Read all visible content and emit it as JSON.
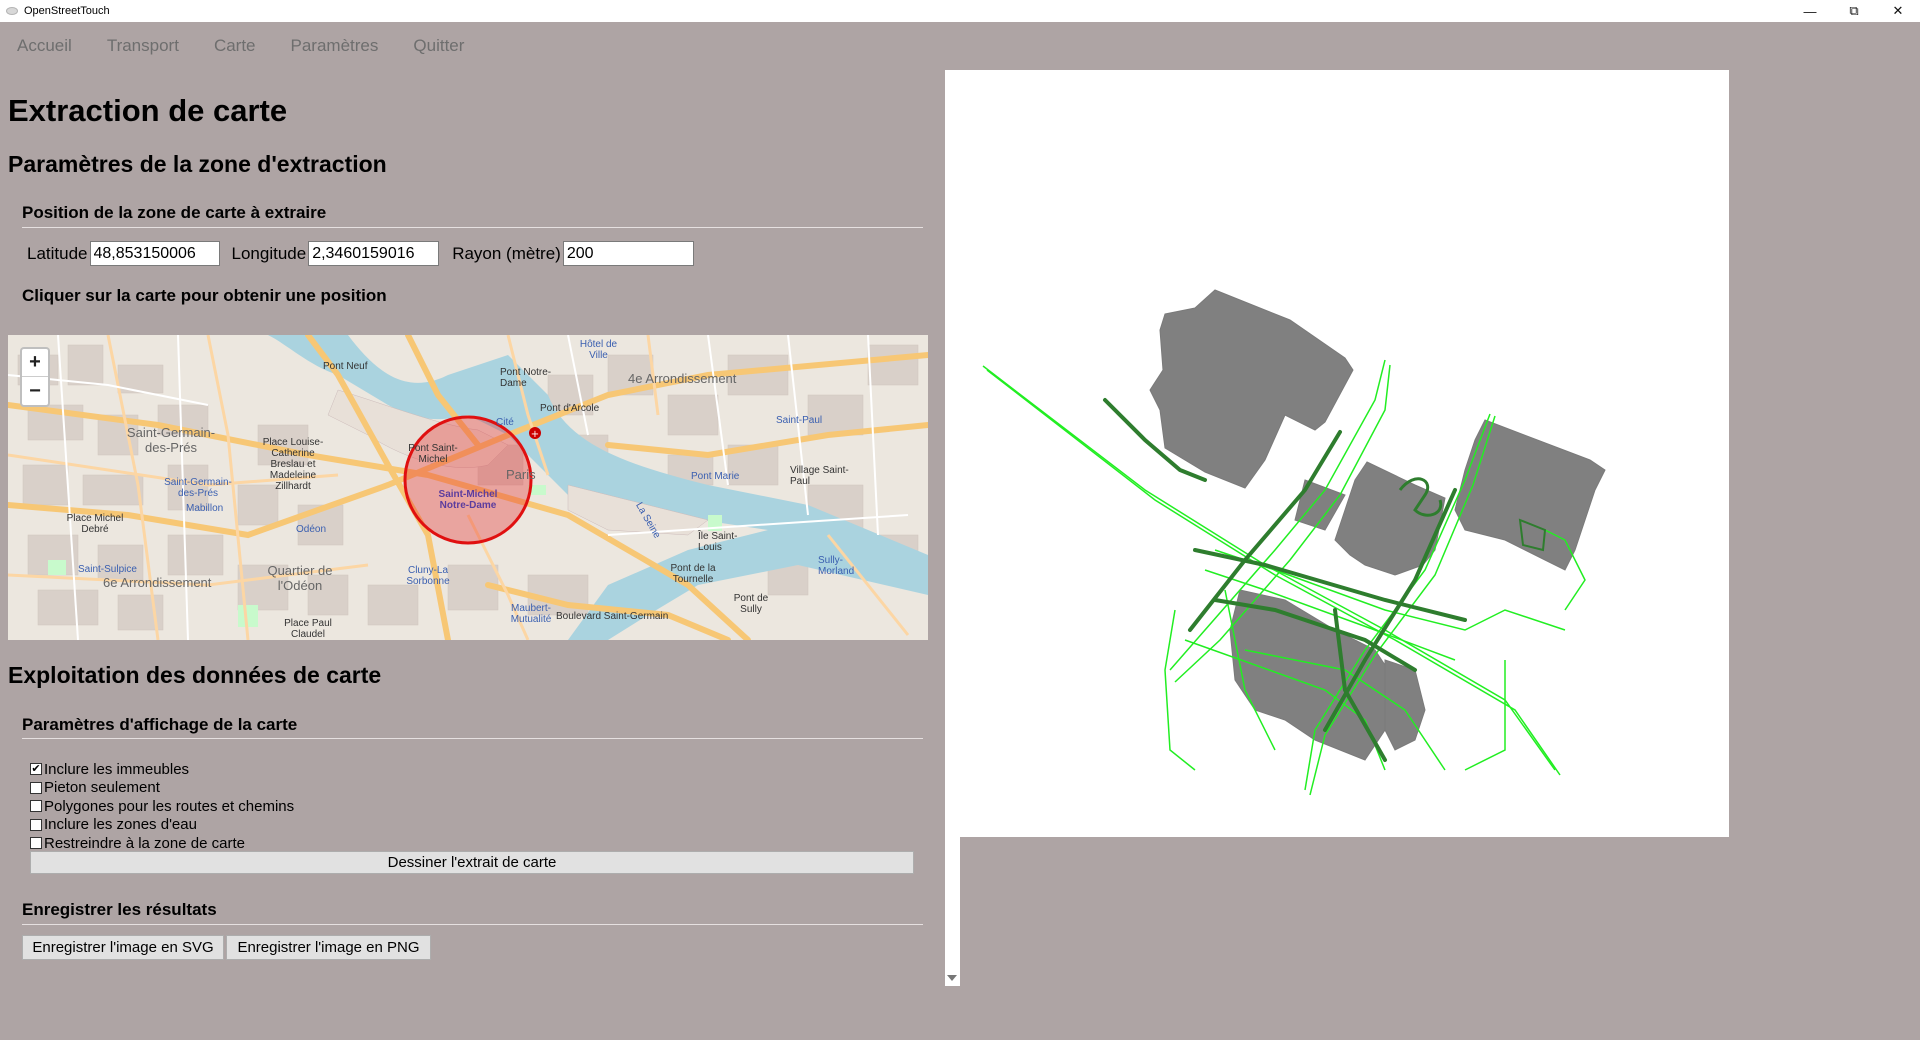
{
  "window": {
    "title": "OpenStreetTouch",
    "minimize": "—",
    "restore": "⧉",
    "close": "✕"
  },
  "menu": [
    "Accueil",
    "Transport",
    "Carte",
    "Paramètres",
    "Quitter"
  ],
  "page_title": "Extraction de carte",
  "extraction": {
    "heading": "Paramètres de la zone d'extraction",
    "position_heading": "Position de la zone de carte à extraire",
    "latitude_label": "Latitude",
    "latitude_value": "48,853150006",
    "longitude_label": "Longitude",
    "longitude_value": "2,3460159016",
    "radius_label": "Rayon (mètre)",
    "radius_value": "200",
    "click_hint": "Cliquer sur la carte pour obtenir une position"
  },
  "map": {
    "zoom_in": "+",
    "zoom_out": "−",
    "labels": {
      "paris": "Paris",
      "st_germain": "Saint-Germain-des-Prés",
      "quartier_odeon": "Quartier de l'Odéon",
      "arr6": "6e Arrondissement",
      "arr4": "4e Arrondissement",
      "st_michel_nd": "Saint-Michel Notre-Dame",
      "pont_neuf": "Pont Neuf",
      "pont_notre_dame": "Pont Notre-Dame",
      "pont_arcole": "Pont d'Arcole",
      "pont_tournelle": "Pont de la Tournelle",
      "pont_sully": "Pont de Sully",
      "pont_marie": "Pont Marie",
      "hotel_ville": "Hôtel de Ville",
      "cite": "Cité",
      "odeon": "Odéon",
      "mabillon": "Mabillon",
      "st_sulpice": "Saint-Sulpice",
      "cluny": "Cluny-La Sorbonne",
      "maubert": "Maubert-Mutualité",
      "bd_st_germain": "Boulevard Saint-Germain",
      "la_seine": "La Seine",
      "ile_st_louis": "Île Saint-Louis",
      "village_st_paul": "Village Saint-Paul",
      "st_paul": "Saint-Paul",
      "sully_morland": "Sully-Morland",
      "place_michel_debre": "Place Michel Debré",
      "place_louise": "Place Louise-Catherine Breslau et Madeleine Zillhardt",
      "st_germain_pres_station": "Saint-Germain-des-Prés",
      "place_paul_claudel": "Place Paul Claudel",
      "st_michel_pont": "Pont Saint-Michel"
    },
    "selection_colors": {
      "stroke": "#e01010",
      "fill": "rgba(230,40,40,0.35)"
    }
  },
  "exploitation": {
    "heading": "Exploitation des données de carte",
    "display_heading": "Paramètres d'affichage de la carte",
    "options": [
      {
        "label": "Inclure les immeubles",
        "checked": "✔"
      },
      {
        "label": "Pieton seulement",
        "checked": ""
      },
      {
        "label": "Polygones pour les routes et chemins",
        "checked": ""
      },
      {
        "label": "Inclure les zones d'eau",
        "checked": ""
      },
      {
        "label": "Restreindre à la zone de carte",
        "checked": ""
      }
    ],
    "draw_button": "Dessiner l'extrait de carte",
    "save_heading": "Enregistrer les résultats",
    "save_svg": "Enregistrer l'image en SVG",
    "save_png": "Enregistrer l'image en PNG"
  },
  "preview_colors": {
    "buildings": "#808080",
    "roads": "#22ee22",
    "main_roads": "#2e7d2e"
  }
}
